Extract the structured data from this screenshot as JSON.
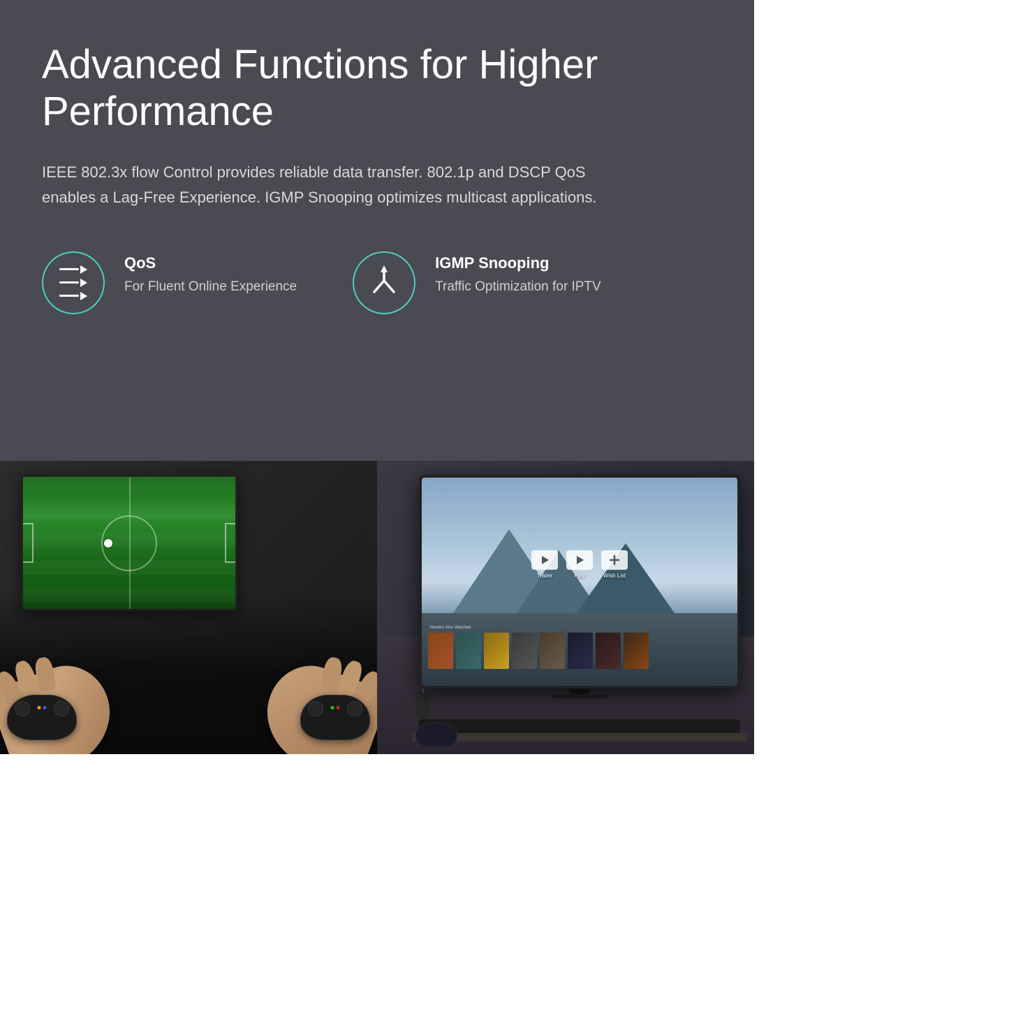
{
  "header": {
    "title": "Advanced Functions for Higher Performance",
    "description": "IEEE 802.3x flow Control provides reliable data transfer. 802.1p and DSCP QoS enables a Lag-Free Experience. IGMP Snooping optimizes multicast applications."
  },
  "features": [
    {
      "id": "qos",
      "title": "QoS",
      "description": "For Fluent Online Experience",
      "icon": "qos-icon"
    },
    {
      "id": "igmp",
      "title": "IGMP Snooping",
      "description": "Traffic Optimization for IPTV",
      "icon": "igmp-icon"
    }
  ],
  "tv_actions": [
    {
      "label": "Trailer",
      "icon": "play-icon"
    },
    {
      "label": "Play",
      "icon": "play-icon"
    },
    {
      "label": "Wish List",
      "icon": "plus-icon"
    }
  ],
  "also_watched_label": "Viewers Also Watched",
  "colors": {
    "teal": "#4ecdc4",
    "background_top": "#4a4a52",
    "text_primary": "#ffffff",
    "text_secondary": "#d0d0d0"
  }
}
